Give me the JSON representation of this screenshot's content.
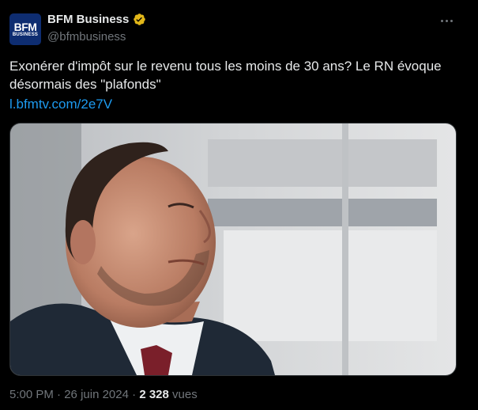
{
  "author": {
    "display_name": "BFM Business",
    "handle": "@bfmbusiness",
    "avatar_text": "BFM",
    "avatar_subtext": "BUSINESS",
    "verified_color": "#e2b719"
  },
  "post": {
    "text": "Exonérer d'impôt sur le revenu tous les moins de 30 ans? Le RN évoque désormais des \"plafonds\"",
    "link": "l.bfmtv.com/2e7V",
    "image_icon": "news-photo"
  },
  "meta": {
    "time": "5:00 PM",
    "separator": "·",
    "date": "26 juin 2024",
    "views_count": "2 328",
    "views_label": "vues"
  },
  "colors": {
    "background": "#000000",
    "text": "#e7e9ea",
    "muted": "#71767b",
    "link": "#1d9bf0"
  }
}
